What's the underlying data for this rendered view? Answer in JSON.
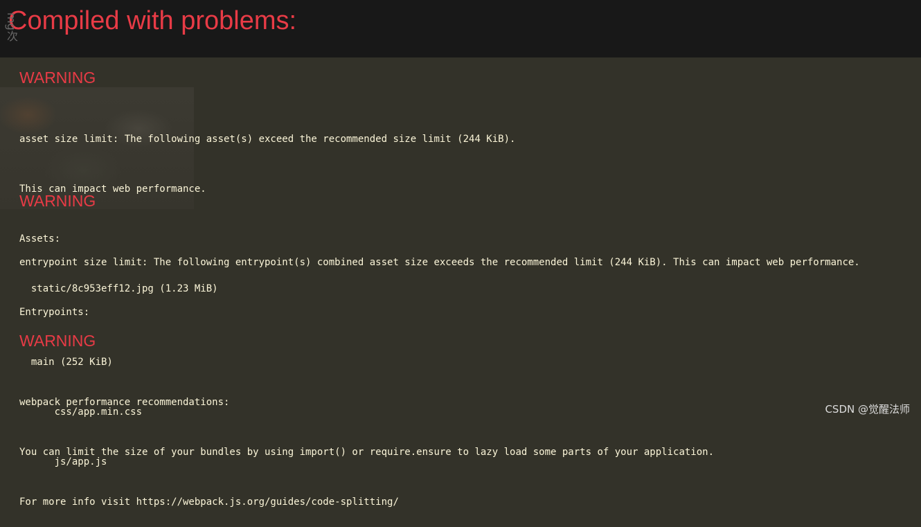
{
  "header": {
    "title": "Compiled with problems:"
  },
  "side_glyphs": "mg次",
  "warnings": [
    {
      "label": "WARNING",
      "lines": [
        "asset size limit: The following asset(s) exceed the recommended size limit (244 KiB).",
        "This can impact web performance.",
        "Assets:",
        "  static/8c953eff12.jpg (1.23 MiB)"
      ]
    },
    {
      "label": "WARNING",
      "lines": [
        "entrypoint size limit: The following entrypoint(s) combined asset size exceeds the recommended limit (244 KiB). This can impact web performance.",
        "Entrypoints:",
        "  main (252 KiB)",
        "      css/app.min.css",
        "      js/app.js"
      ]
    },
    {
      "label": "WARNING",
      "lines": [
        "webpack performance recommendations:",
        "You can limit the size of your bundles by using import() or require.ensure to lazy load some parts of your application.",
        "For more info visit https://webpack.js.org/guides/code-splitting/"
      ]
    }
  ],
  "watermark": "CSDN @觉醒法师",
  "colors": {
    "header_bg": "#181818",
    "body_bg": "#333229",
    "accent_red": "#e83b46",
    "message_text": "#fbf5d8"
  }
}
